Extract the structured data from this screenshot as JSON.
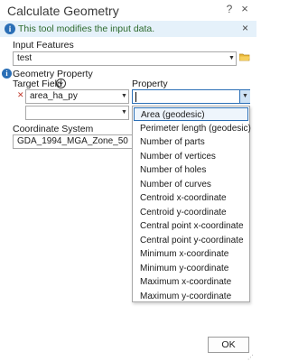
{
  "window": {
    "title": "Calculate Geometry",
    "help": "?",
    "close": "×"
  },
  "banner": {
    "icon": "i",
    "text": "This tool modifies the input data.",
    "close": "×"
  },
  "input_features": {
    "label": "Input Features",
    "value": "test"
  },
  "geometry_property": {
    "label": "Geometry Property",
    "target_field_label": "Target Field",
    "property_label": "Property",
    "rows": [
      {
        "target_field": "area_ha_py",
        "property": ""
      },
      {
        "target_field": "",
        "property": ""
      }
    ]
  },
  "coordinate_system": {
    "label": "Coordinate System",
    "value": "GDA_1994_MGA_Zone_50"
  },
  "property_options": [
    "Area (geodesic)",
    "Perimeter length (geodesic)",
    "Number of parts",
    "Number of vertices",
    "Number of holes",
    "Number of curves",
    "Centroid x-coordinate",
    "Centroid y-coordinate",
    "Central point x-coordinate",
    "Central point y-coordinate",
    "Minimum x-coordinate",
    "Minimum y-coordinate",
    "Maximum x-coordinate",
    "Maximum y-coordinate"
  ],
  "selected_option_index": 0,
  "buttons": {
    "ok": "OK"
  },
  "icons": {
    "info": "info-icon",
    "folder": "folder-icon",
    "remove": "remove-x-icon",
    "collapse": "chevron-circle-icon"
  },
  "colors": {
    "banner_bg": "#e5f1fa",
    "banner_text": "#2d6a2d",
    "accent": "#2b6fb6",
    "remove": "#c0392b"
  }
}
